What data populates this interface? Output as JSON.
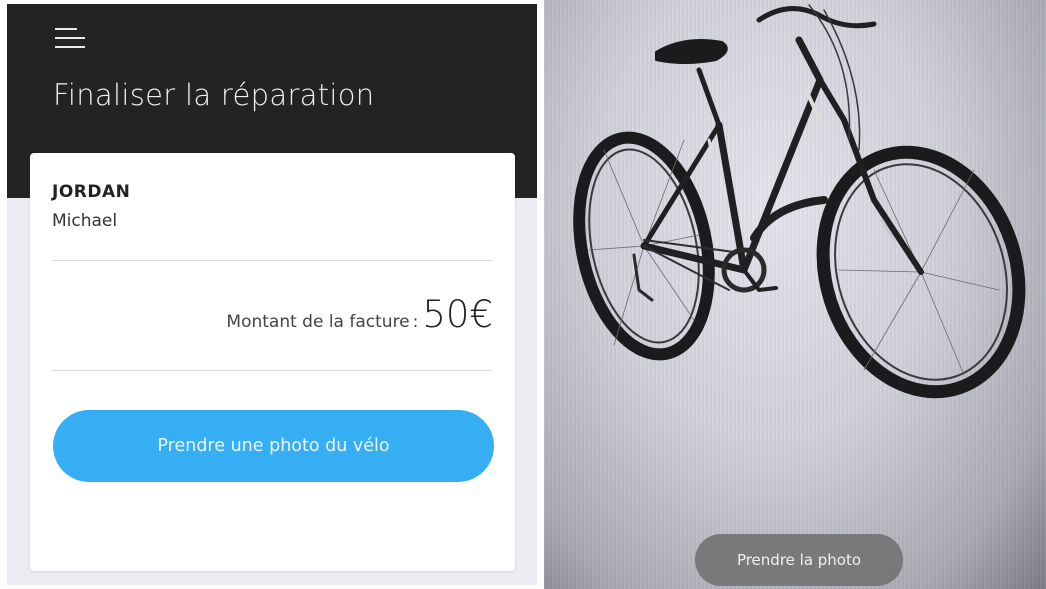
{
  "repair": {
    "title": "Finaliser la réparation",
    "customer": {
      "last_name": "JORDAN",
      "first_name": "Michael"
    },
    "amount_label": "Montant de la facture",
    "amount_separator": ":",
    "amount_value": "50€",
    "photo_button_label": "Prendre une photo du vélo"
  },
  "camera": {
    "capture_button_label": "Prendre la photo"
  },
  "icons": {
    "menu": "hamburger-menu-icon"
  },
  "colors": {
    "header_bg": "#232323",
    "accent": "#36aef3",
    "page_bg": "#ecedf2"
  }
}
